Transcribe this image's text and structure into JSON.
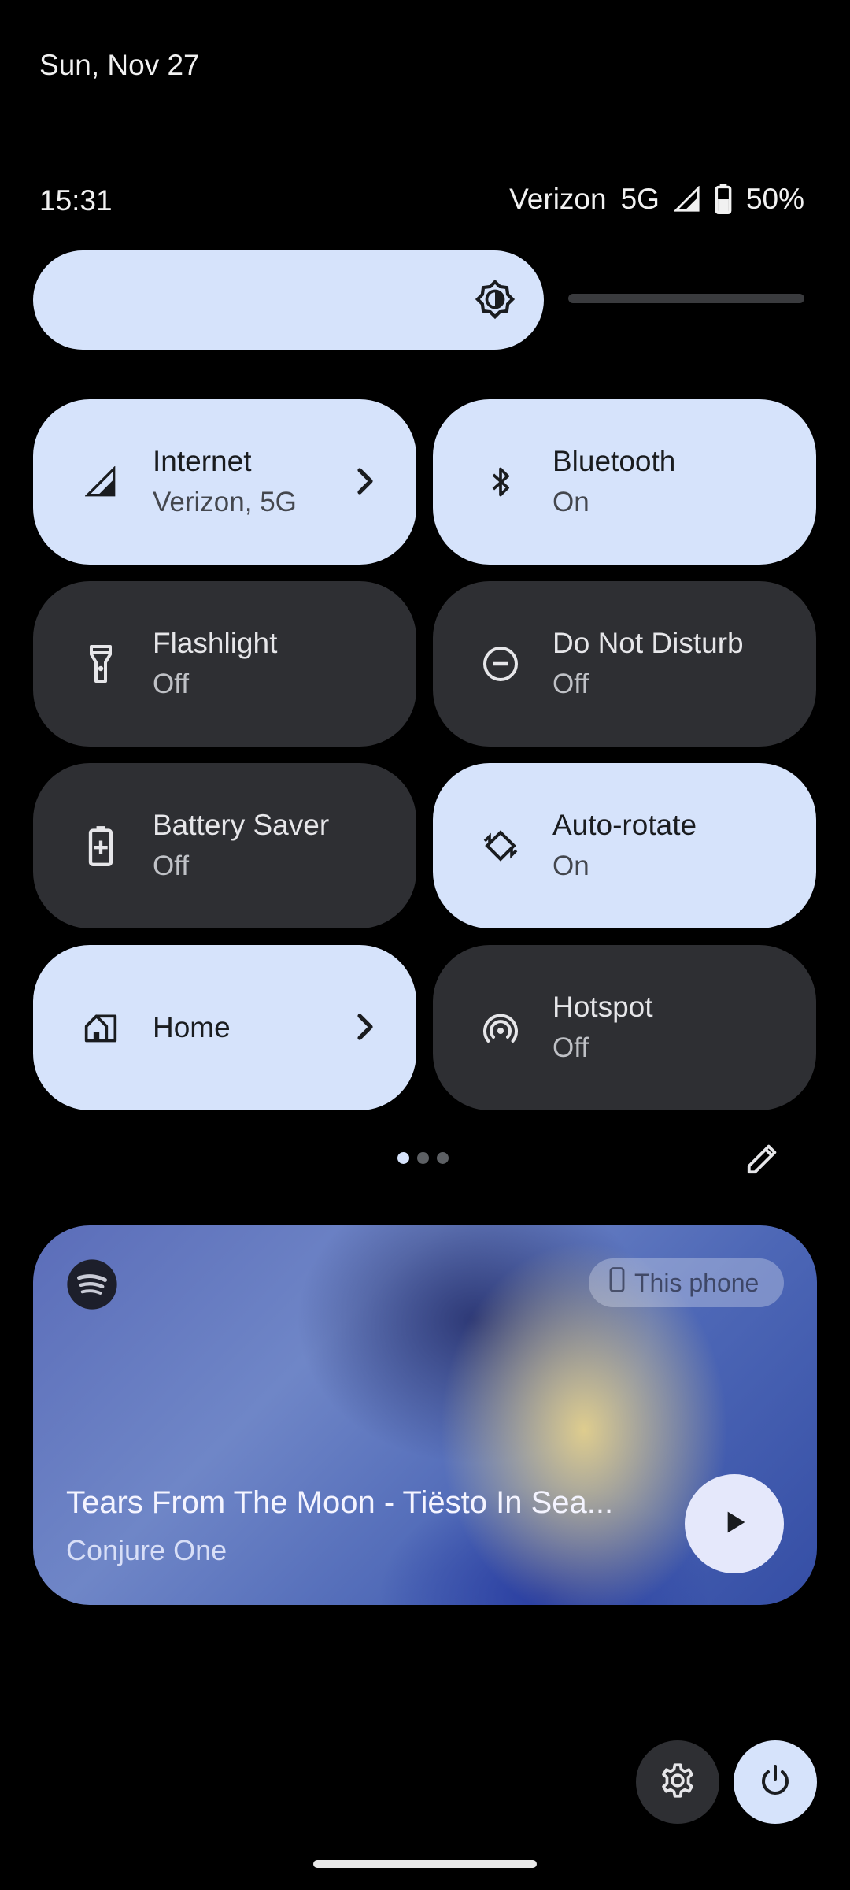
{
  "header": {
    "date": "Sun, Nov 27",
    "time": "15:31"
  },
  "status_bar": {
    "carrier": "Verizon",
    "network": "5G",
    "battery": "50%"
  },
  "brightness": {
    "level_fraction": 0.69
  },
  "tiles": [
    {
      "title": "Internet",
      "subtitle": "Verizon, 5G",
      "state": "on",
      "icon": "signal-icon",
      "has_chevron": true
    },
    {
      "title": "Bluetooth",
      "subtitle": "On",
      "state": "on",
      "icon": "bluetooth-icon",
      "has_chevron": false
    },
    {
      "title": "Flashlight",
      "subtitle": "Off",
      "state": "off",
      "icon": "flashlight-icon",
      "has_chevron": false
    },
    {
      "title": "Do Not Disturb",
      "subtitle": "Off",
      "state": "off",
      "icon": "do-not-disturb-icon",
      "has_chevron": false
    },
    {
      "title": "Battery Saver",
      "subtitle": "Off",
      "state": "off",
      "icon": "battery-saver-icon",
      "has_chevron": false
    },
    {
      "title": "Auto-rotate",
      "subtitle": "On",
      "state": "on",
      "icon": "auto-rotate-icon",
      "has_chevron": false
    },
    {
      "title": "Home",
      "subtitle": "",
      "state": "on",
      "icon": "home-icon",
      "has_chevron": true
    },
    {
      "title": "Hotspot",
      "subtitle": "Off",
      "state": "off",
      "icon": "hotspot-icon",
      "has_chevron": false
    }
  ],
  "pager": {
    "pages": 3,
    "current": 1
  },
  "media": {
    "app_icon": "spotify-icon",
    "output_device": "This phone",
    "song_title": "Tears From The Moon - Tiësto In Sea...",
    "artist": "Conjure One"
  },
  "colors": {
    "tile_on": "#d6e3fb",
    "tile_off": "#2e2f33",
    "background": "#000000"
  }
}
